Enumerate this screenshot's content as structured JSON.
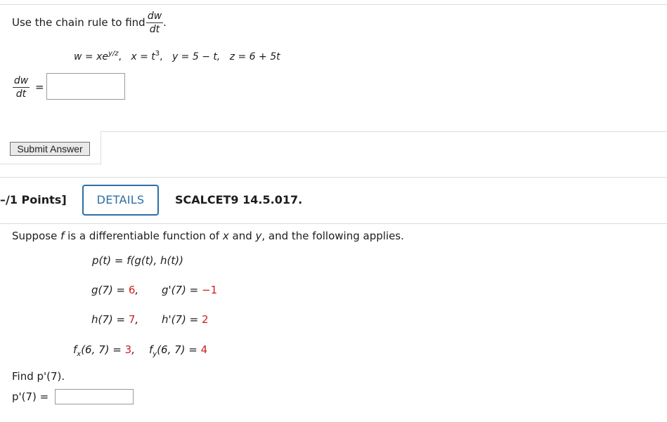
{
  "q1": {
    "prompt": "Use the chain rule to find",
    "frac_num": "dw",
    "frac_den": "dt",
    "period": ".",
    "eq_w": "w = xe",
    "eq_w_exp": "y/z",
    "eq_x": "x = t",
    "eq_x_exp": "3",
    "eq_y": "y = 5 − t,",
    "eq_z": "z = 6 + 5t",
    "answer_lhs_num": "dw",
    "answer_lhs_den": "dt",
    "answer_eq": "=",
    "answer_value": "",
    "submit_label": "Submit Answer"
  },
  "q2": {
    "points": "–/1 Points]",
    "details_label": "DETAILS",
    "code": "SCALCET9 14.5.017.",
    "intro_a": "Suppose ",
    "intro_f": "f",
    "intro_b": " is a differentiable function of ",
    "intro_x": "x",
    "intro_c": " and ",
    "intro_y": "y",
    "intro_d": ", and the following applies.",
    "p_def": "p(t) = f(g(t), h(t))",
    "g7": "g(7) = 6,",
    "g7_val": "6",
    "gp7": "g'(7) = −1",
    "h7": "h(7) = 7,",
    "hp7": "h'(7) = 2",
    "fx": "fx(6, 7) = 3,",
    "fy": "fy(6, 7) = 4",
    "find": "Find p'(7).",
    "answer_lhs": "p'(7) =",
    "answer_value": ""
  }
}
